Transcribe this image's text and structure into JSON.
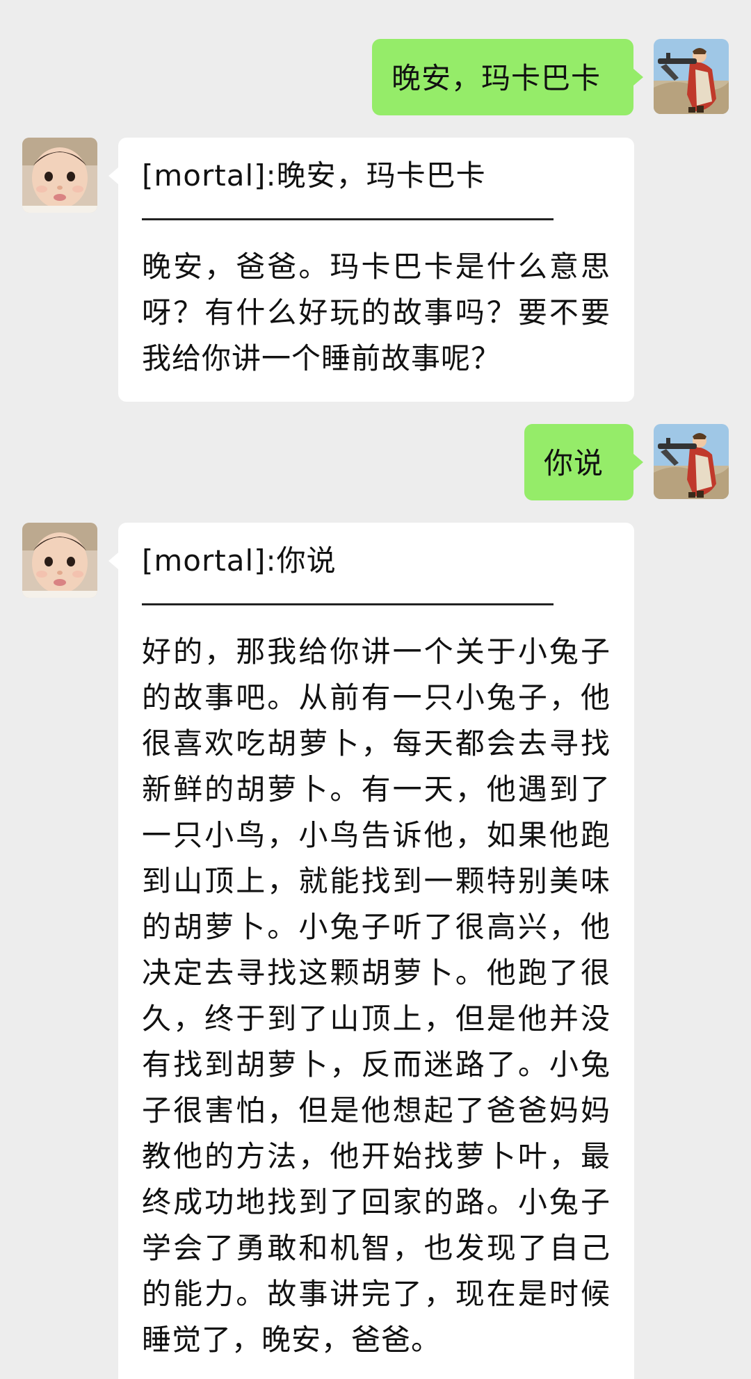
{
  "conversation": {
    "messages": [
      {
        "sender": "me",
        "text": "晚安，玛卡巴卡"
      },
      {
        "sender": "bot",
        "quote": "[mortal]:晚安，玛卡巴卡",
        "reply": "晚安，爸爸。玛卡巴卡是什么意思呀？有什么好玩的故事吗？要不要我给你讲一个睡前故事呢？"
      },
      {
        "sender": "me",
        "text": "你说"
      },
      {
        "sender": "bot",
        "quote": "[mortal]:你说",
        "reply": "好的，那我给你讲一个关于小兔子的故事吧。从前有一只小兔子，他很喜欢吃胡萝卜，每天都会去寻找新鲜的胡萝卜。有一天，他遇到了一只小鸟，小鸟告诉他，如果他跑到山顶上，就能找到一颗特别美味的胡萝卜。小兔子听了很高兴，他决定去寻找这颗胡萝卜。他跑了很久，终于到了山顶上，但是他并没有找到胡萝卜，反而迷路了。小兔子很害怕，但是他想起了爸爸妈妈教他的方法，他开始找萝卜叶，最终成功地找到了回家的路。小兔子学会了勇敢和机智，也发现了自己的能力。故事讲完了，现在是时候睡觉了，晚安，爸爸。"
      }
    ]
  },
  "colors": {
    "background": "#ededed",
    "my_bubble": "#95ec69",
    "bot_bubble": "#ffffff",
    "text": "#111111"
  },
  "icons": {
    "my_avatar": "user-avatar-soldier-icon",
    "bot_avatar": "bot-avatar-baby-icon"
  }
}
